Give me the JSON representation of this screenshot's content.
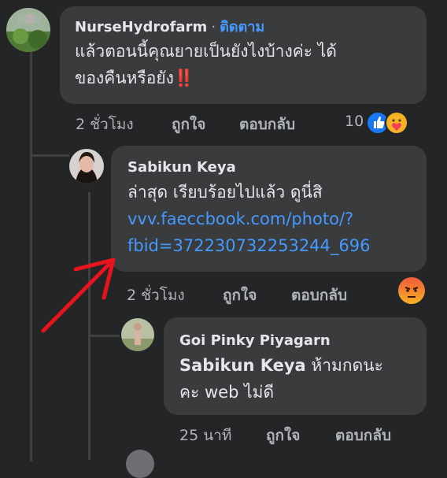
{
  "comments": [
    {
      "author": "NurseHydrofarm",
      "separator": "·",
      "follow_label": "ติดตาม",
      "text_line1": "แล้วตอนนี้คุณยายเป็นยังไงบ้างค่ะ ได้",
      "text_line2": "ของคืนหรือยัง",
      "emoji": "‼️",
      "time": "2 ชั่วโมง",
      "like_label": "ถูกใจ",
      "reply_label": "ตอบกลับ",
      "reaction_count": "10",
      "reaction_icons": [
        "like-reaction-icon",
        "care-reaction-icon"
      ]
    },
    {
      "author": "Sabikun Keya",
      "text_line1": "ล่าสุด เรียบร้อยไปแล้ว ดูนี่สิ",
      "link_line1": "vvv.faeccbook.com/photo/?",
      "link_line2": "fbid=372230732253244_696",
      "time": "2 ชั่วโมง",
      "like_label": "ถูกใจ",
      "reply_label": "ตอบกลับ",
      "reaction_icons": [
        "angry-reaction-icon"
      ]
    },
    {
      "author": "Goi Pinky Piyagarn",
      "mention": "Sabikun Keya",
      "text_line1_rest": " ห้ามกดนะ",
      "text_line2": "คะ web ไม่ดี",
      "time": "25 นาที",
      "like_label": "ถูกใจ",
      "reply_label": "ตอบกลับ"
    }
  ],
  "colors": {
    "background": "#242526",
    "bubble": "#3a3b3c",
    "link": "#4599ff",
    "annotation_arrow": "#e8141c"
  }
}
